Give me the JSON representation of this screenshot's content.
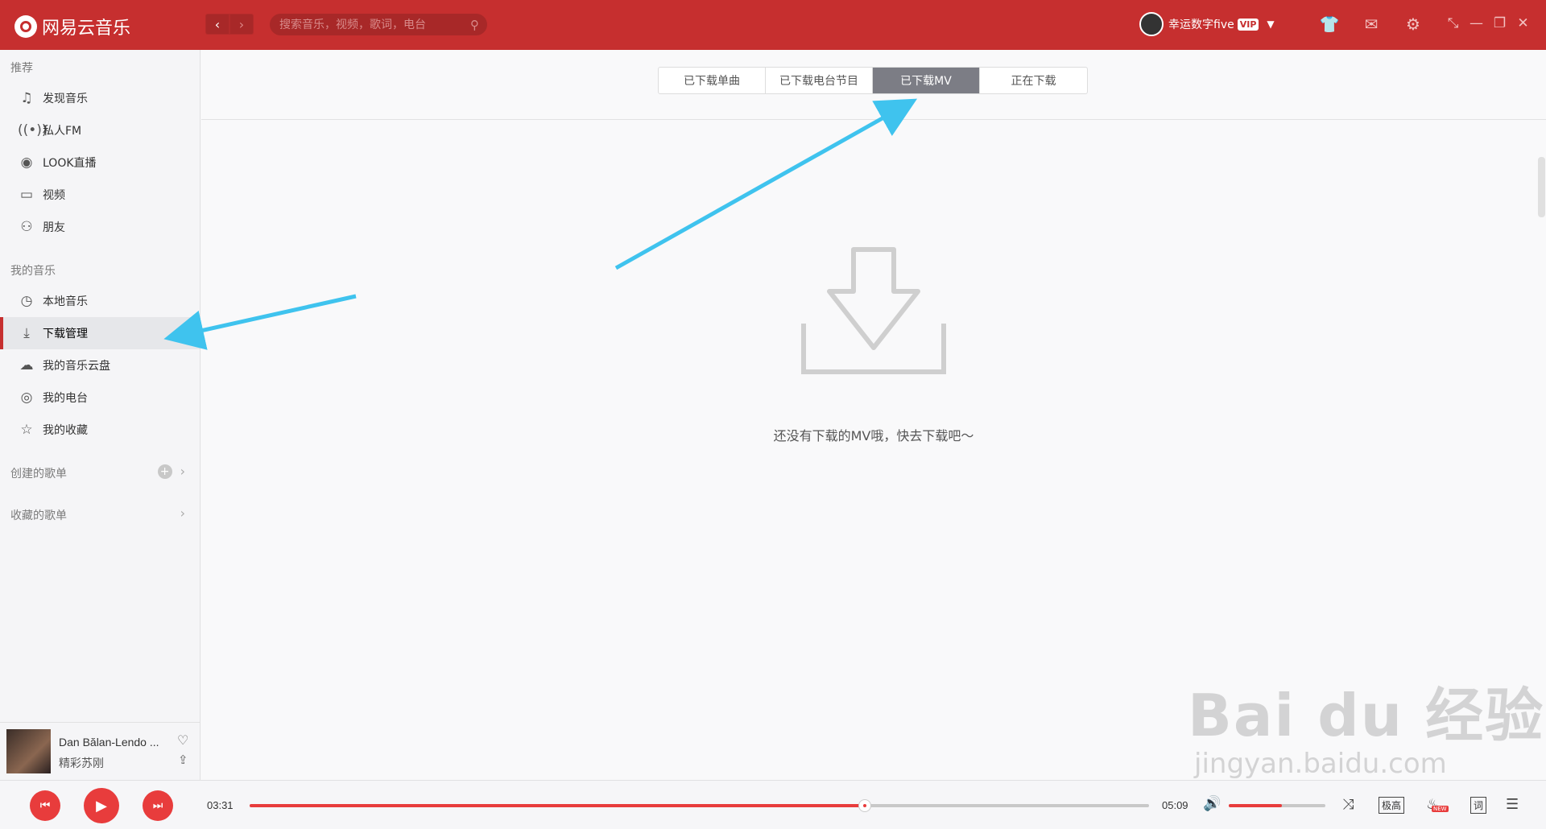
{
  "app": {
    "title": "网易云音乐"
  },
  "header": {
    "back_icon": "chevron-left-icon",
    "forward_icon": "chevron-right-icon",
    "search_placeholder": "搜索音乐，视频，歌词，电台",
    "username": "幸运数字five",
    "vip_label": "VIP"
  },
  "sidebar": {
    "recommend_title": "推荐",
    "recommend_items": [
      {
        "label": "发现音乐",
        "icon": "music-note-icon"
      },
      {
        "label": "私人FM",
        "icon": "radio-icon"
      },
      {
        "label": "LOOK直播",
        "icon": "live-icon"
      },
      {
        "label": "视频",
        "icon": "video-icon"
      },
      {
        "label": "朋友",
        "icon": "friends-icon"
      }
    ],
    "my_music_title": "我的音乐",
    "my_music_items": [
      {
        "label": "本地音乐",
        "icon": "local-music-icon"
      },
      {
        "label": "下载管理",
        "icon": "download-icon"
      },
      {
        "label": "我的音乐云盘",
        "icon": "cloud-icon"
      },
      {
        "label": "我的电台",
        "icon": "podcast-icon"
      },
      {
        "label": "我的收藏",
        "icon": "favorites-icon"
      }
    ],
    "created_playlists": "创建的歌单",
    "collected_playlists": "收藏的歌单"
  },
  "now_playing": {
    "title": "Dan Bălan-Lendo ...",
    "artist": "精彩苏刚"
  },
  "tabs": [
    "已下载单曲",
    "已下载电台节目",
    "已下载MV",
    "正在下载"
  ],
  "active_tab": 2,
  "empty_message": "还没有下载的MV哦，快去下载吧～",
  "player": {
    "elapsed": "03:31",
    "duration": "05:09",
    "progress_fraction": 0.684,
    "volume_fraction": 0.55,
    "quality_label": "极高",
    "lyrics_label": "词",
    "new_badge": "NEW"
  },
  "watermark": {
    "line1": "Bai du 经验",
    "line2": "jingyan.baidu.com"
  },
  "colors": {
    "brand_red": "#c62f2f",
    "accent_red": "#e83c3c",
    "arrow_blue": "#3fc3ee",
    "active_tab": "#7c7d85"
  }
}
